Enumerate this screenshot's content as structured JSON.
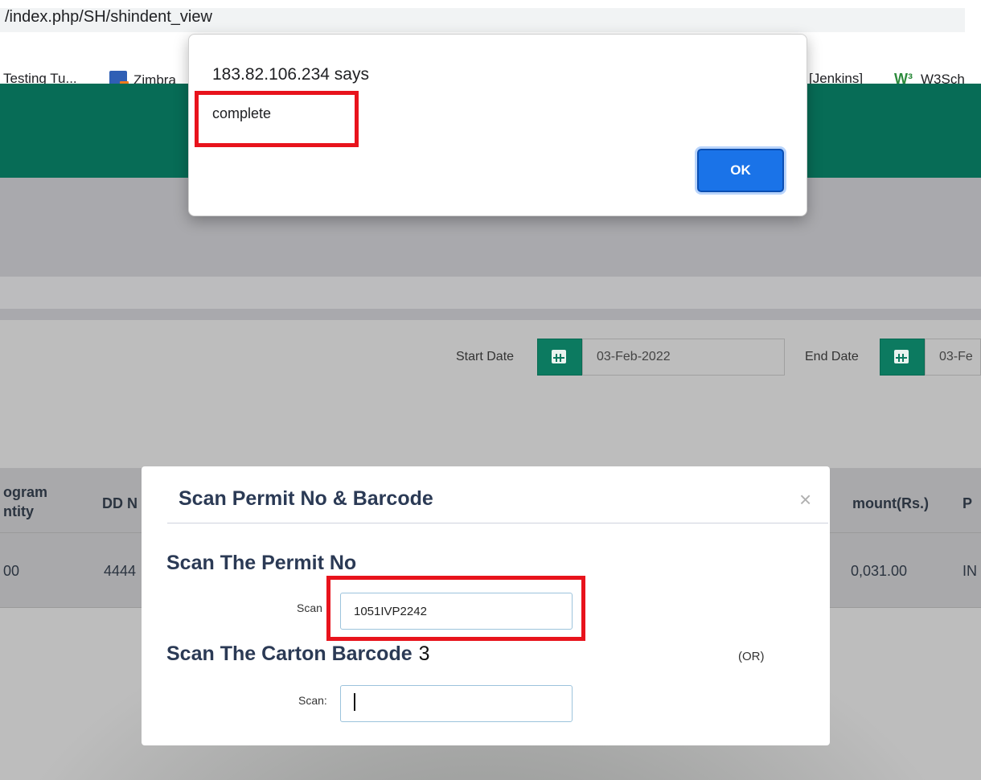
{
  "browser": {
    "url": "/index.php/SH/shindent_view",
    "bookmarks": [
      {
        "label": "Testing Tu..."
      },
      {
        "label": "Zimbra"
      },
      {
        "label": "[Jenkins]"
      },
      {
        "label": "W3Sch"
      }
    ]
  },
  "alert": {
    "title": "183.82.106.234 says",
    "message": "complete",
    "ok_label": "OK"
  },
  "filters": {
    "start_label": "Start Date",
    "start_value": "03-Feb-2022",
    "end_label": "End Date",
    "end_value": "03-Fe"
  },
  "table": {
    "headers": {
      "col1_line1": "ogram",
      "col1_line2": "ntity",
      "col2": "DD N",
      "amount": "mount(Rs.)",
      "last": "P"
    },
    "row": {
      "col1": "00",
      "col2": "4444",
      "amount": "0,031.00",
      "last": "IN"
    }
  },
  "modal": {
    "title": "Scan Permit No & Barcode",
    "close_symbol": "×",
    "permit_heading": "Scan The Permit No",
    "permit_label": "Scan",
    "permit_value": "1051IVP2242",
    "carton_heading": "Scan The Carton Barcode",
    "carton_count": "3",
    "or_text": "(OR)",
    "carton_label": "Scan:",
    "carton_value": ""
  },
  "colors": {
    "header_teal": "#076c56",
    "highlight_red": "#e8131c",
    "ok_blue": "#1a73e8"
  }
}
